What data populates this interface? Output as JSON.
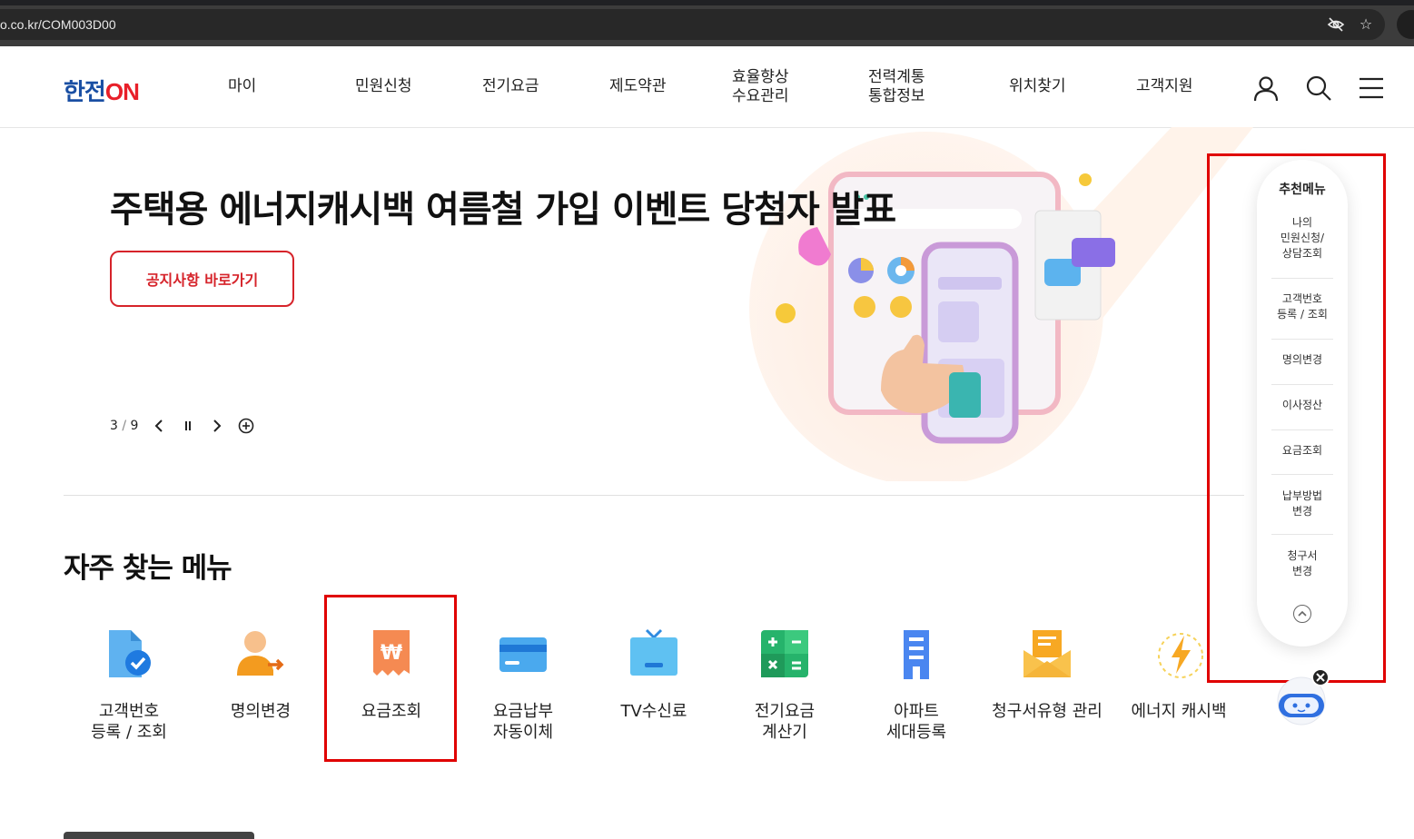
{
  "browser": {
    "url": "o.co.kr/COM003D00"
  },
  "header": {
    "logo_left": "한전",
    "logo_right": "ON",
    "nav": [
      {
        "label": "마이"
      },
      {
        "label": "민원신청"
      },
      {
        "label": "전기요금"
      },
      {
        "label": "제도약관"
      },
      {
        "label": "효율향상\n수요관리"
      },
      {
        "label": "전력계통\n통합정보"
      },
      {
        "label": "위치찾기"
      },
      {
        "label": "고객지원"
      }
    ],
    "icons": [
      "user-icon",
      "search-icon",
      "menu-icon"
    ]
  },
  "banner": {
    "title": "주택용 에너지캐시백 여름철 가입 이벤트 당첨자 발표",
    "button_label": "공지사항 바로가기",
    "page_current": "3",
    "page_total": "9"
  },
  "frequent": {
    "title": "자주 찾는 메뉴",
    "items": [
      {
        "label": "고객번호\n등록 / 조회",
        "icon": "document-check-icon"
      },
      {
        "label": "명의변경",
        "icon": "person-change-icon"
      },
      {
        "label": "요금조회",
        "icon": "won-receipt-icon"
      },
      {
        "label": "요금납부\n자동이체",
        "icon": "credit-card-icon"
      },
      {
        "label": "TV수신료",
        "icon": "tv-icon"
      },
      {
        "label": "전기요금\n계산기",
        "icon": "calculator-icon"
      },
      {
        "label": "아파트\n세대등록",
        "icon": "apartment-icon"
      },
      {
        "label": "청구서유형 관리",
        "icon": "envelope-icon"
      },
      {
        "label": "에너지 캐시백",
        "icon": "lightning-icon"
      }
    ]
  },
  "recommend": {
    "title": "추천메뉴",
    "items": [
      {
        "label": "나의\n민원신청/\n상담조회"
      },
      {
        "label": "고객번호\n등록 / 조회"
      },
      {
        "label": "명의변경"
      },
      {
        "label": "이사정산"
      },
      {
        "label": "요금조회"
      },
      {
        "label": "납부방법\n변경"
      },
      {
        "label": "청구서\n변경"
      }
    ]
  },
  "colors": {
    "brand_blue": "#1a4fa3",
    "brand_red": "#d6232a",
    "highlight": "#e00000"
  }
}
